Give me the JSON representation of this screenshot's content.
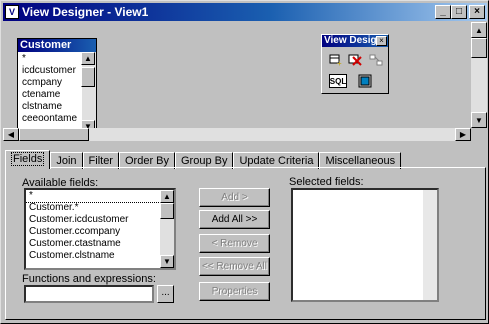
{
  "window": {
    "title": "View Designer - View1",
    "buttons": {
      "minimize": "_",
      "maximize": "□",
      "close": "×"
    }
  },
  "table": {
    "title": "Customer",
    "fields": [
      "*",
      "icdcustomer",
      "ccmpany",
      "ctename",
      "clstname",
      "ceeoontame"
    ]
  },
  "toolbox": {
    "title": "View Desig",
    "sql_label": "SQL"
  },
  "tabs": [
    "Fields",
    "Join",
    "Filter",
    "Order By",
    "Group By",
    "Update Criteria",
    "Miscellaneous"
  ],
  "fields_tab": {
    "available_label": "Available fields:",
    "available_items": [
      "*",
      "Customer.*",
      "Customer.icdcustomer",
      "Customer.ccompany",
      "Customer.ctastname",
      "Customer.clstname"
    ],
    "functions_label": "Functions and expressions:",
    "ellipsis": "...",
    "selected_label": "Selected fields:",
    "buttons": {
      "add": "Add >",
      "add_all": "Add All >>",
      "remove": "< Remove",
      "remove_all": "<< Remove All",
      "properties": "Properties"
    }
  },
  "colors": {
    "titlebar_start": "#000080",
    "titlebar_end": "#a6caf0",
    "face": "#c0c0c0"
  }
}
